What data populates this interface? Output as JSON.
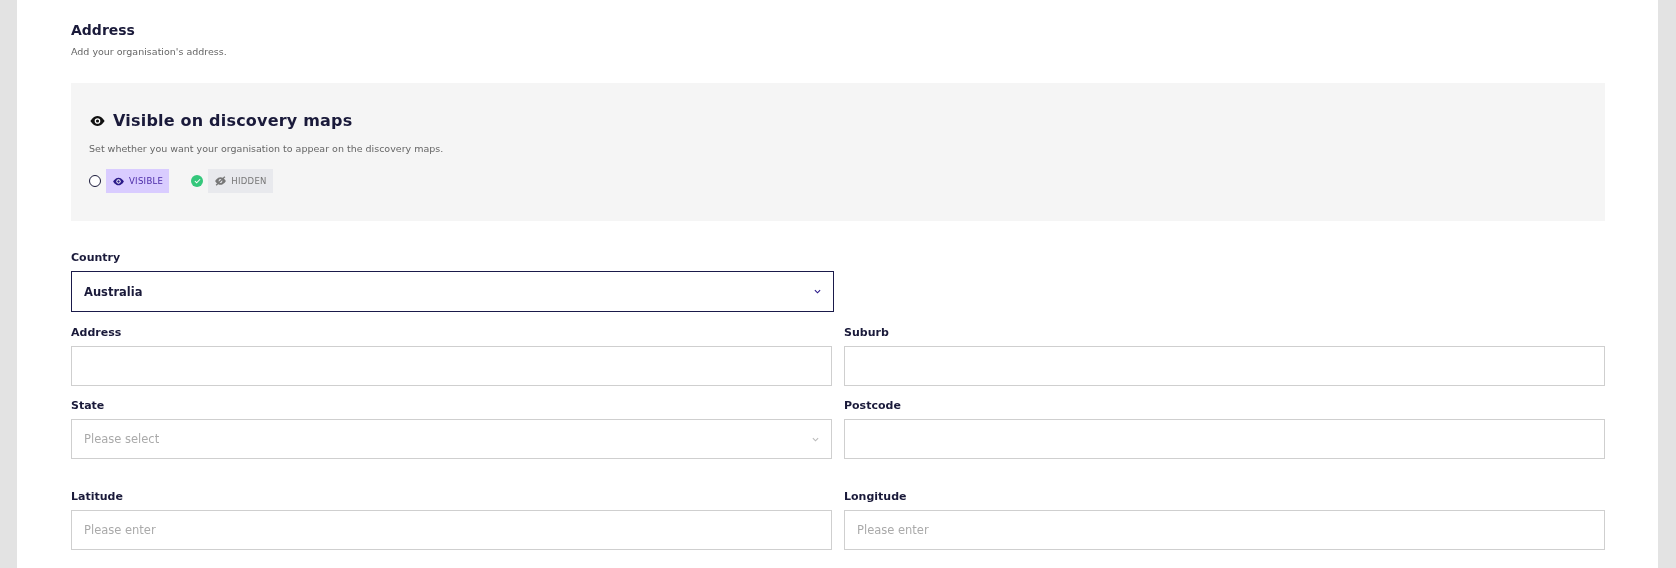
{
  "section": {
    "title": "Address",
    "subtitle": "Add your organisation's address."
  },
  "visibility": {
    "title": "Visible on discovery maps",
    "description": "Set whether you want your organisation to appear on the discovery maps.",
    "options": [
      {
        "kind": "visible",
        "label": "VISIBLE",
        "selected": false
      },
      {
        "kind": "hidden",
        "label": "HIDDEN",
        "selected": true
      }
    ]
  },
  "country": {
    "label": "Country",
    "value": "Australia",
    "focused": true
  },
  "fields": [
    {
      "kind": "input",
      "label": "Address"
    },
    {
      "kind": "input",
      "label": "Suburb"
    },
    {
      "kind": "select",
      "label": "State",
      "placeholder": "Please select"
    },
    {
      "kind": "input",
      "label": "Postcode"
    },
    {
      "kind": "input",
      "label": "Latitude",
      "placeholder": "Please enter"
    },
    {
      "kind": "input",
      "label": "Longitude",
      "placeholder": "Please enter"
    }
  ]
}
